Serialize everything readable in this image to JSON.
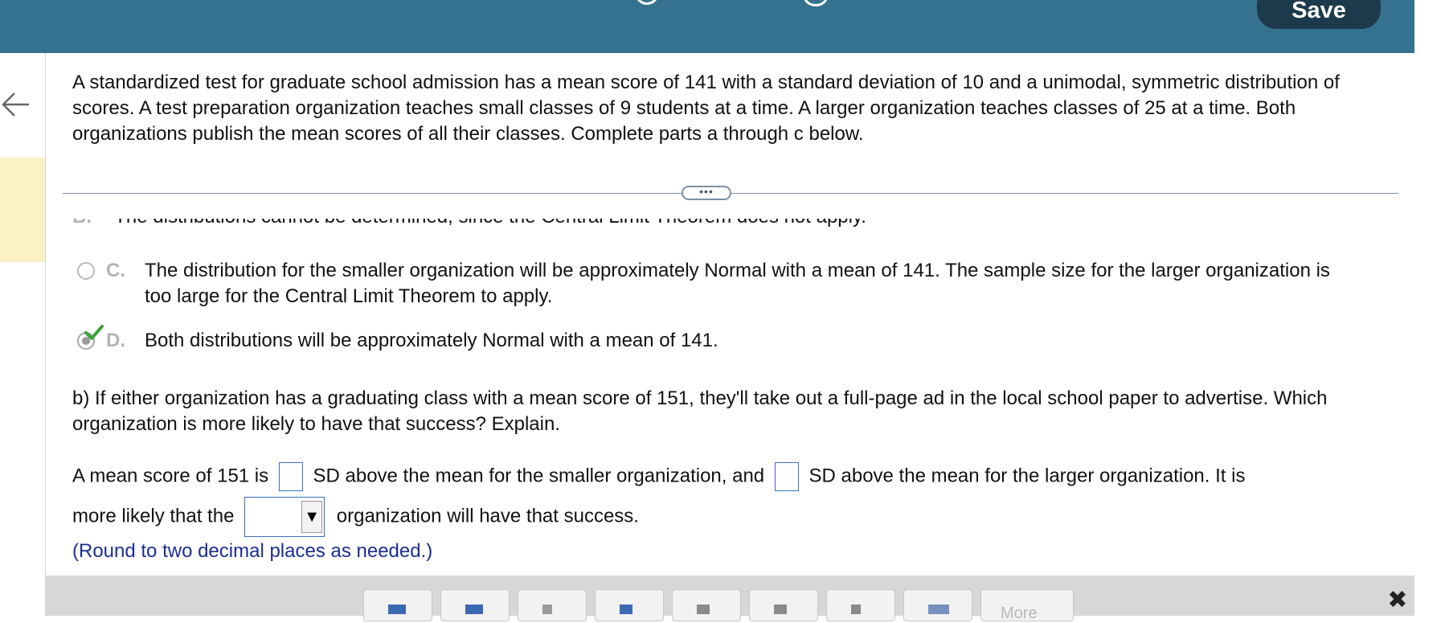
{
  "toolbar": {
    "save_label": "Save"
  },
  "question": {
    "text": "A standardized test for graduate school admission has a mean score of 141 with a standard deviation of 10 and a unimodal, symmetric distribution of scores. A test preparation organization teaches small classes of 9 students at a time. A larger organization teaches classes of 25 at a time. Both organizations publish the mean scores of all their classes. Complete parts a through c below."
  },
  "divider": {
    "handle_label": "•••"
  },
  "options": [
    {
      "letter": "B.",
      "text": "The distributions cannot be determined, since the Central Limit Theorem does not apply."
    },
    {
      "letter": "C.",
      "text": "The distribution for the smaller organization will be approximately Normal with a mean of 141. The sample size for the larger organization is too large for the Central Limit Theorem to apply."
    },
    {
      "letter": "D.",
      "text": "Both distributions will be approximately Normal with a mean of 141."
    }
  ],
  "part_b": {
    "prompt": "b) If either organization has a graduating class with a mean score of 151, they'll take out a full-page ad in the local school paper to advertise. Which organization is more likely to have that success? Explain.",
    "sentence_1": "A mean score of 151 is",
    "sentence_2": "SD above the mean for the smaller organization, and",
    "sentence_3": "SD above the mean for the larger organization. It is",
    "sentence_4": "more likely that the",
    "sentence_5": "organization will have that success.",
    "hint": "(Round to two decimal places as needed.)",
    "dropdown_arrow": "▼"
  },
  "math_toolbar": {
    "more_label": "More",
    "close_symbol": "✖"
  }
}
